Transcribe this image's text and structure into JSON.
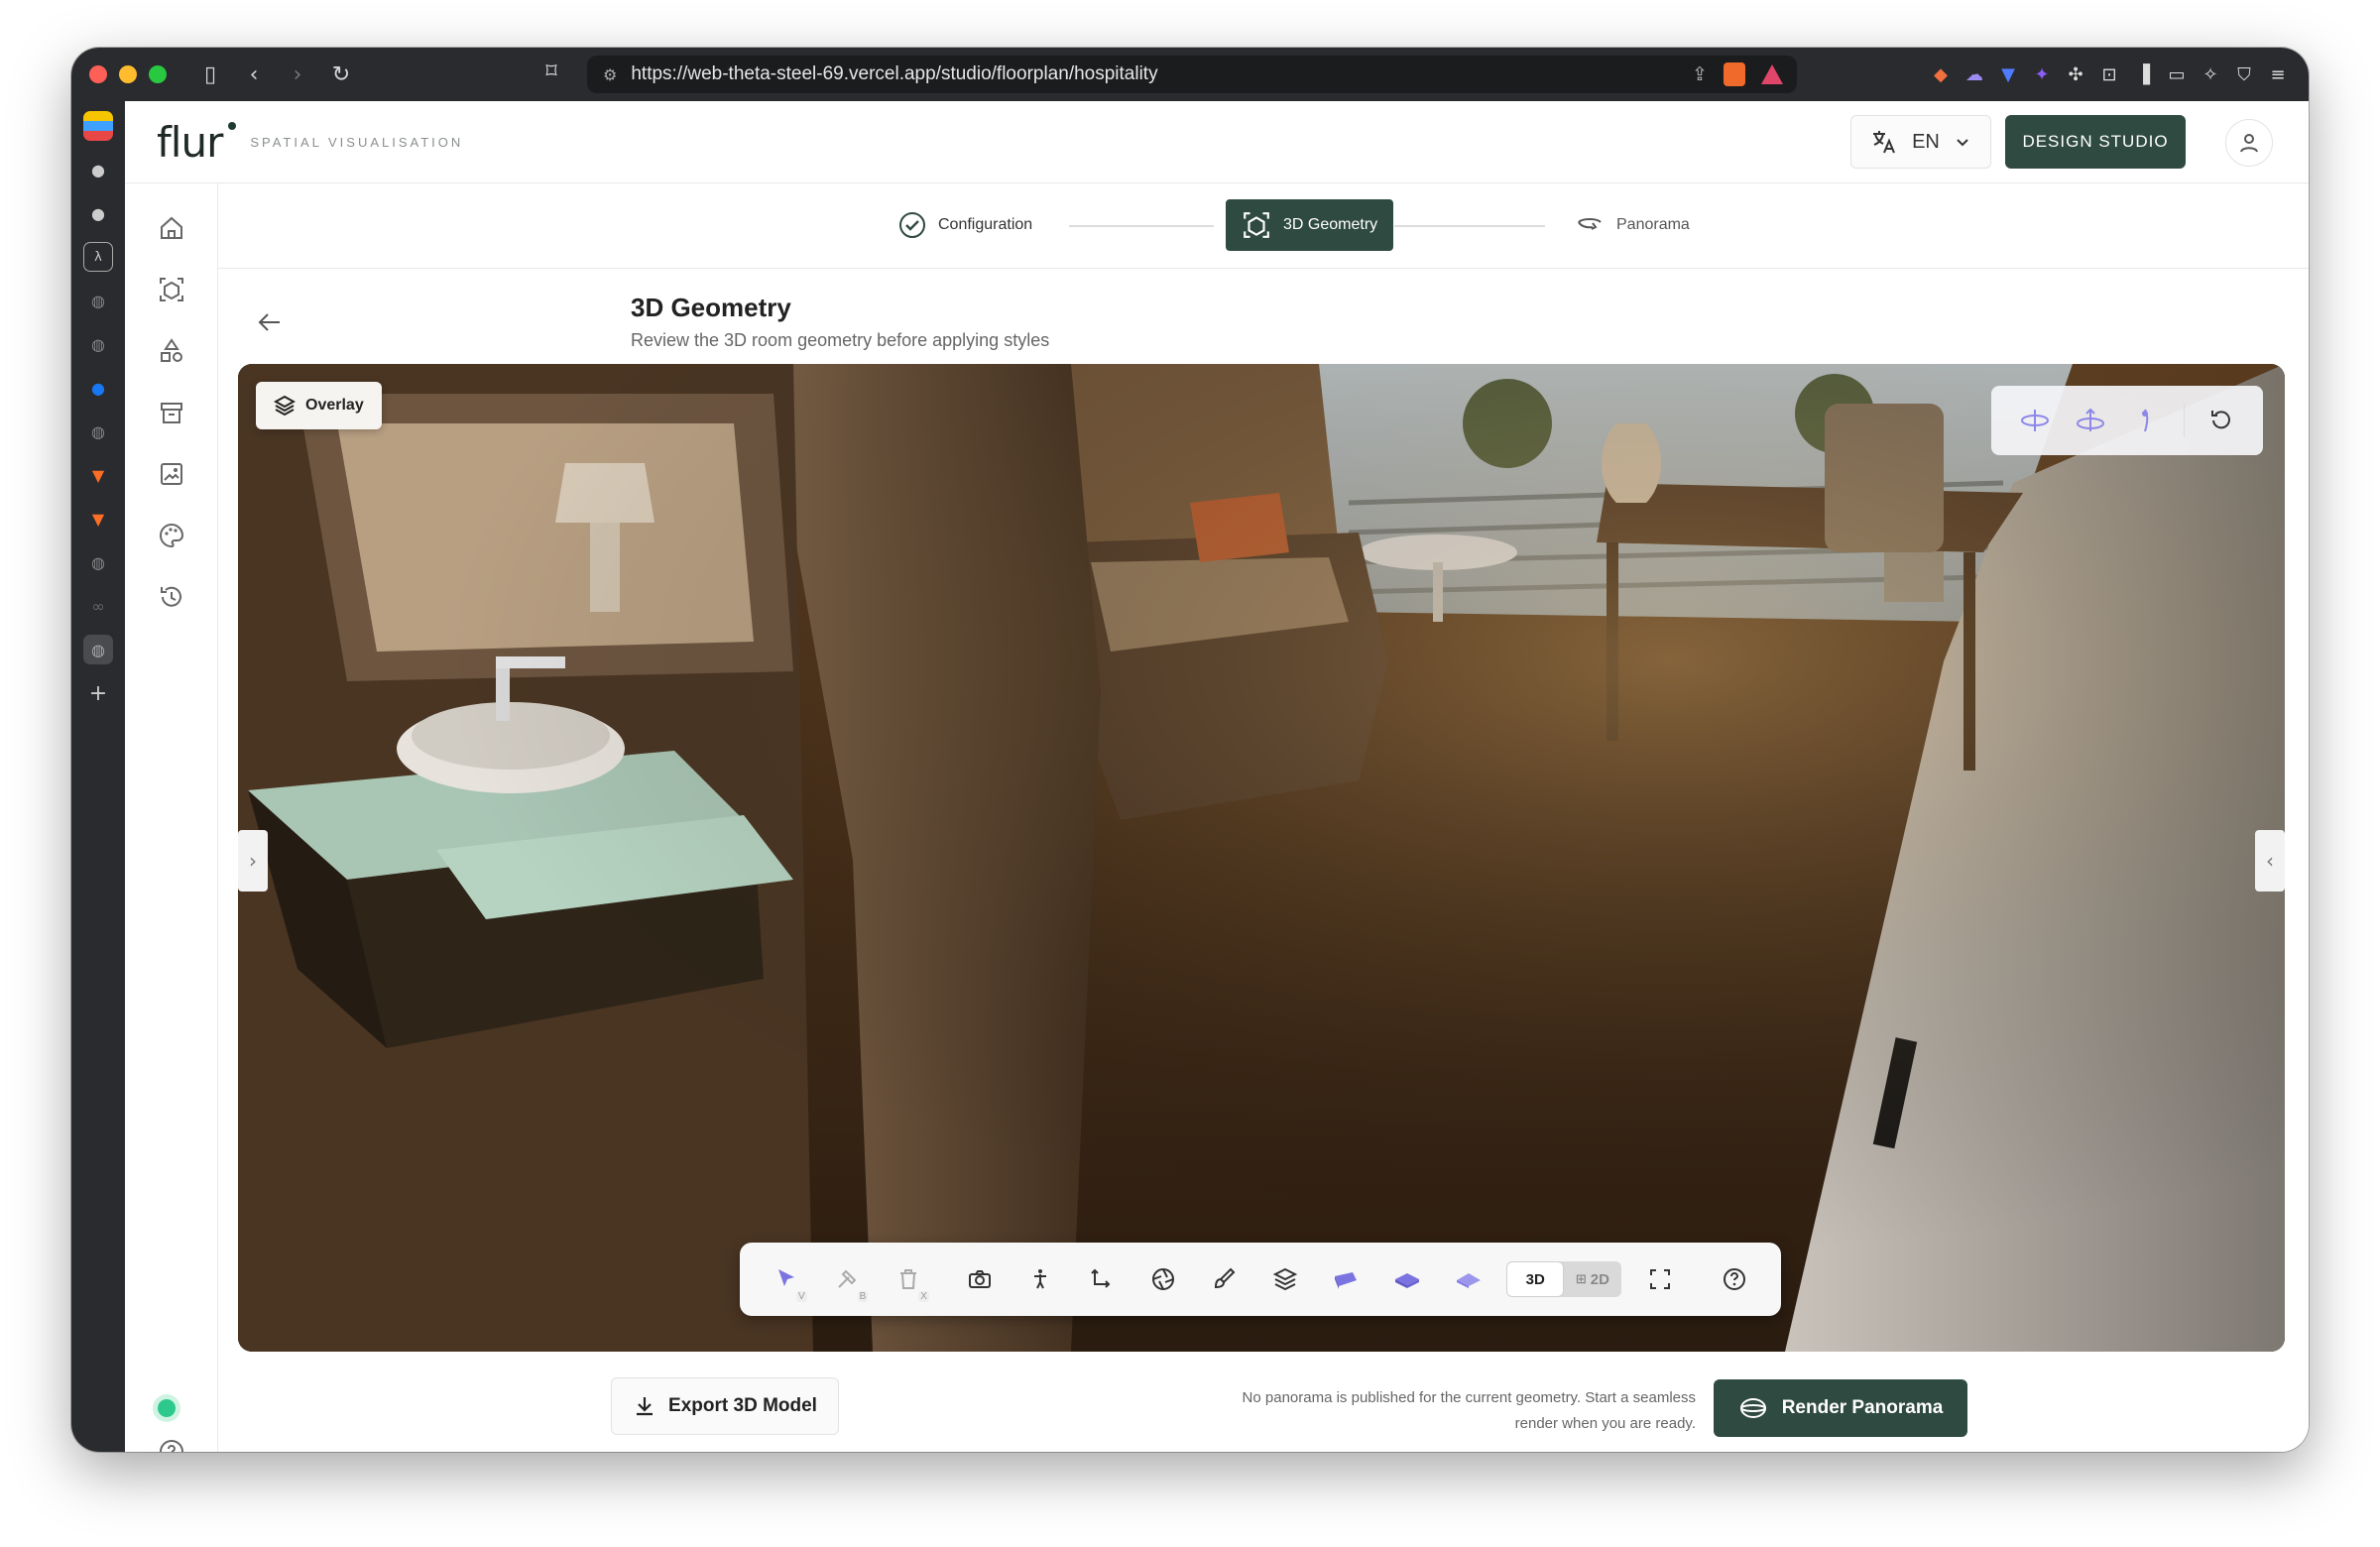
{
  "browser": {
    "url": "https://web-theta-steel-69.vercel.app/studio/floorplan/hospitality"
  },
  "header": {
    "logo": "flur",
    "tagline": "SPATIAL VISUALISATION",
    "language": "EN",
    "design_studio": "DESIGN STUDIO"
  },
  "steps": [
    {
      "label": "Configuration",
      "state": "completed"
    },
    {
      "label": "3D Geometry",
      "state": "active"
    },
    {
      "label": "Panorama",
      "state": "upcoming"
    }
  ],
  "page": {
    "title": "3D Geometry",
    "subtitle": "Review the 3D room geometry before applying styles"
  },
  "viewport": {
    "overlay_label": "Overlay",
    "view_modes": [
      "3D",
      "2D"
    ],
    "active_view_mode": "3D"
  },
  "toolbar": {
    "select_key": "V",
    "build_key": "B",
    "delete_key": "X"
  },
  "footer": {
    "export_label": "Export 3D Model",
    "note": "No panorama is published for the current geometry. Start a seamless render when you are ready.",
    "render_label": "Render Panorama"
  },
  "colors": {
    "brand": "#2f4a40",
    "status_online": "#2dc98a",
    "accent_purple": "#7b74e0"
  }
}
